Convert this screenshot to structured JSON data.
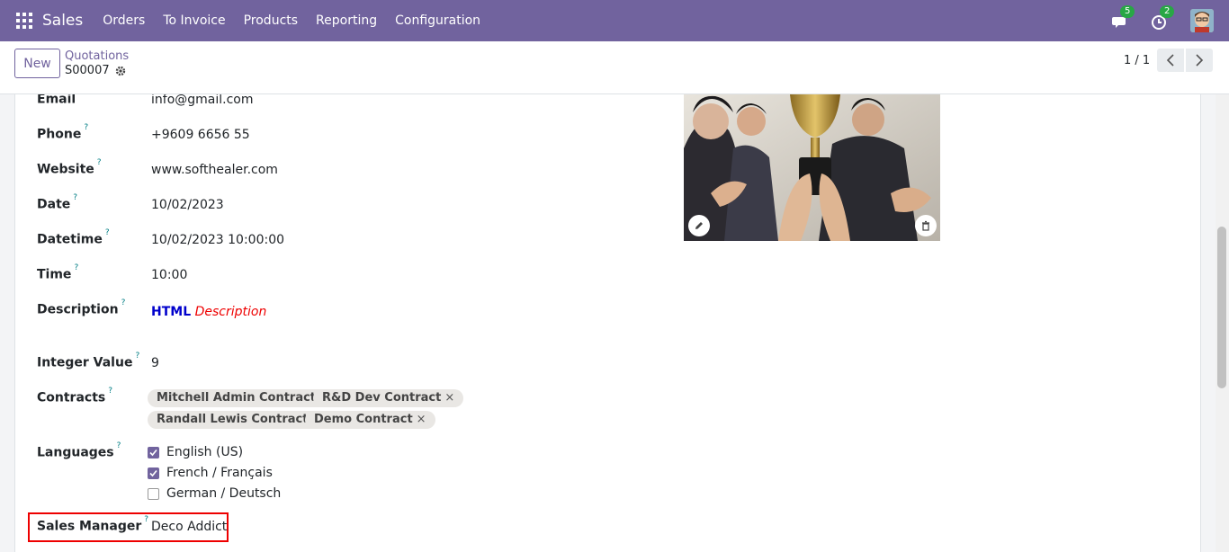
{
  "navbar": {
    "app_name": "Sales",
    "menu": [
      "Orders",
      "To Invoice",
      "Products",
      "Reporting",
      "Configuration"
    ],
    "messages_count": "5",
    "activities_count": "2",
    "accent": "#71639e"
  },
  "control": {
    "new_label": "New",
    "breadcrumb": "Quotations",
    "record": "S00007",
    "pager": "1 / 1"
  },
  "fields": {
    "email": {
      "label": "Email",
      "help": "?",
      "value": "info@gmail.com"
    },
    "phone": {
      "label": "Phone",
      "help": "?",
      "value": "+9609 6656 55"
    },
    "website": {
      "label": "Website",
      "help": "?",
      "value": "www.softhealer.com"
    },
    "date": {
      "label": "Date",
      "help": "?",
      "value": "10/02/2023"
    },
    "datetime": {
      "label": "Datetime",
      "help": "?",
      "value": "10/02/2023 10:00:00"
    },
    "time": {
      "label": "Time",
      "help": "?",
      "value": "10:00"
    },
    "description": {
      "label": "Description",
      "help": "?",
      "bold": "HTML",
      "italic": "Description"
    },
    "integer": {
      "label": "Integer Value",
      "help": "?",
      "value": "9"
    },
    "contracts": {
      "label": "Contracts",
      "help": "?",
      "tags": [
        "Mitchell Admin Contract",
        "R&D Dev Contract",
        "Randall Lewis Contract",
        "Demo Contract"
      ],
      "remove": "×"
    },
    "languages": {
      "label": "Languages",
      "help": "?",
      "options": [
        {
          "name": "English (US)",
          "checked": true
        },
        {
          "name": "French / Français",
          "checked": true
        },
        {
          "name": "German / Deutsch",
          "checked": false
        }
      ]
    },
    "sales_manager": {
      "label": "Sales Manager",
      "help": "?",
      "value": "Deco Addict"
    }
  }
}
